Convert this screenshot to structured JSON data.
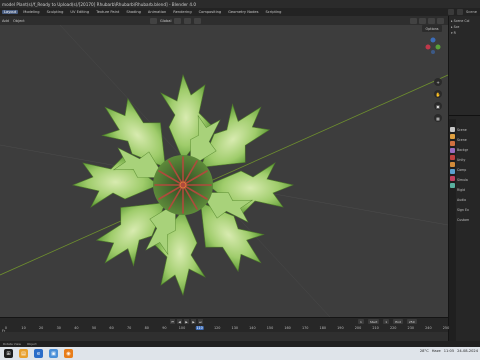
{
  "window": {
    "title": "model Plant(s)/f_Ready to Upload(s)/[20170] Rhubarb\\Rhubarb\\Rhubarb.blend] - Blender 4.0"
  },
  "menubar": {
    "tabs": [
      "Layout",
      "Modeling",
      "Sculpting",
      "UV Editing",
      "Texture Paint",
      "Shading",
      "Animation",
      "Rendering",
      "Compositing",
      "Geometry Nodes",
      "Scripting"
    ],
    "active_tab": "Layout",
    "scene": "Scene"
  },
  "viewport_header": {
    "items": [
      "Add",
      "Object"
    ],
    "transform": "Global",
    "options": "Options"
  },
  "outliner": {
    "rows": [
      "Scene Col",
      "Sce",
      "R"
    ]
  },
  "properties": {
    "rows": [
      "Scene",
      "Scene",
      "Backgr",
      "Unity",
      "Comp",
      "Simula",
      "Rigid",
      "Audio",
      "Sign Ex",
      "Custom"
    ]
  },
  "timeline": {
    "ticks": [
      "0",
      "10",
      "20",
      "30",
      "40",
      "50",
      "60",
      "70",
      "80",
      "90",
      "100",
      "110",
      "120",
      "130",
      "140",
      "150",
      "160",
      "170",
      "180",
      "190",
      "200",
      "210",
      "220",
      "230",
      "240",
      "250"
    ],
    "current_frame": "110",
    "fields": [
      "1",
      "Start",
      "1",
      "End",
      "250"
    ],
    "label": "Fr"
  },
  "statusbar": {
    "items": [
      "Rotate View",
      "Object"
    ]
  },
  "taskbar": {
    "temperature": "28°C",
    "weather": "Haze",
    "time": "11:05",
    "date": "24-08-2024"
  },
  "colors": {
    "accent": "#4a5e82",
    "leaf_light": "#b9dc8e",
    "leaf_dark": "#4f8f2a",
    "stalk": "#b04a3c",
    "viewport_bg": "#3d3d3d",
    "grid_line": "#6e8f2e"
  }
}
